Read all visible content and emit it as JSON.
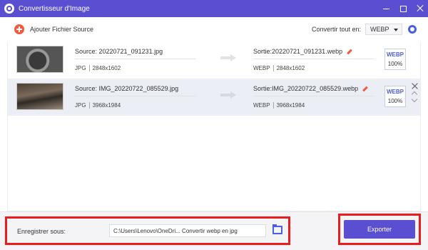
{
  "window": {
    "title": "Convertisseur d'Image"
  },
  "toolbar": {
    "add_label": "Ajouter Fichier Source",
    "convert_all_label": "Convertir tout en:",
    "convert_all_value": "WEBP"
  },
  "files": [
    {
      "source_name": "Source: 20220721_091231.jpg",
      "source_format": "JPG",
      "source_dims": "2848x1602",
      "output_name": "Sortie:20220721_091231.webp",
      "output_format": "WEBP",
      "output_dims": "2848x1602",
      "badge_format": "WEBP",
      "badge_quality": "100%"
    },
    {
      "source_name": "Source: IMG_20220722_085529.jpg",
      "source_format": "JPG",
      "source_dims": "3968x1984",
      "output_name": "Sortie:IMG_20220722_085529.webp",
      "output_format": "WEBP",
      "output_dims": "3968x1984",
      "badge_format": "WEBP",
      "badge_quality": "100%"
    }
  ],
  "bottom": {
    "save_label": "Enregistrer sous:",
    "save_path": "C:\\Users\\Lenovo\\OneDri... Convertir webp en jpg",
    "export_label": "Exporter"
  },
  "colors": {
    "accent": "#5a4fd1",
    "add_icon": "#f05a3e",
    "highlight_border": "#e81e1e",
    "badge_text": "#4a5fe0"
  },
  "icons": {
    "app": "converter-logo-icon",
    "add": "plus-circle-icon",
    "settings": "gear-icon",
    "arrow": "arrow-right-icon",
    "edit": "pencil-icon",
    "folder": "folder-icon",
    "close": "close-icon"
  }
}
